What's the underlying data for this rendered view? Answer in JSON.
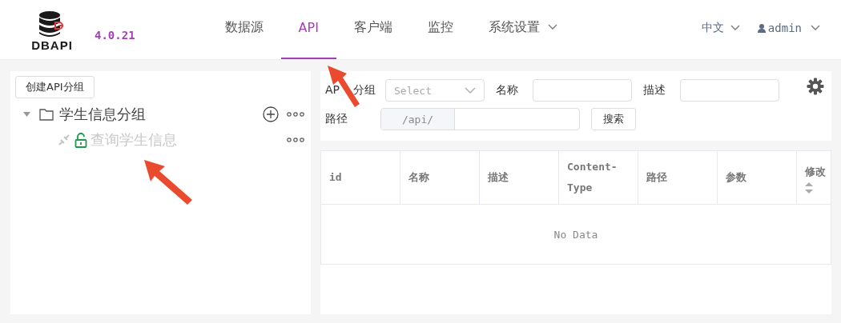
{
  "header": {
    "logo_text": "DBAPI",
    "version": "4.0.21",
    "nav": [
      {
        "label": "数据源",
        "selected": false,
        "has_menu": false
      },
      {
        "label": "API",
        "selected": true,
        "has_menu": false
      },
      {
        "label": "客户端",
        "selected": false,
        "has_menu": false
      },
      {
        "label": "监控",
        "selected": false,
        "has_menu": false
      },
      {
        "label": "系统设置",
        "selected": false,
        "has_menu": true
      }
    ],
    "language": "中文",
    "user": "admin"
  },
  "sidebar": {
    "create_button": "创建API分组",
    "tree": [
      {
        "label": "学生信息分组",
        "expanded": true,
        "children": [
          {
            "label": "查询学生信息",
            "locked": false,
            "published": false
          }
        ]
      }
    ]
  },
  "filters": {
    "group_label_parts": [
      "AP",
      "分组"
    ],
    "group_placeholder": "Select",
    "name_label": "名称",
    "desc_label": "描述",
    "path_label": "路径",
    "path_prefix": "/api/",
    "search_button": "搜索"
  },
  "table": {
    "columns": [
      {
        "label": "id",
        "sortable": false
      },
      {
        "label": "名称",
        "sortable": false
      },
      {
        "label": "描述",
        "sortable": false
      },
      {
        "label": "Content-Type",
        "sortable": false
      },
      {
        "label": "路径",
        "sortable": false
      },
      {
        "label": "参数",
        "sortable": false
      },
      {
        "label": "修改",
        "sortable": true
      }
    ],
    "empty_text": "No Data"
  }
}
